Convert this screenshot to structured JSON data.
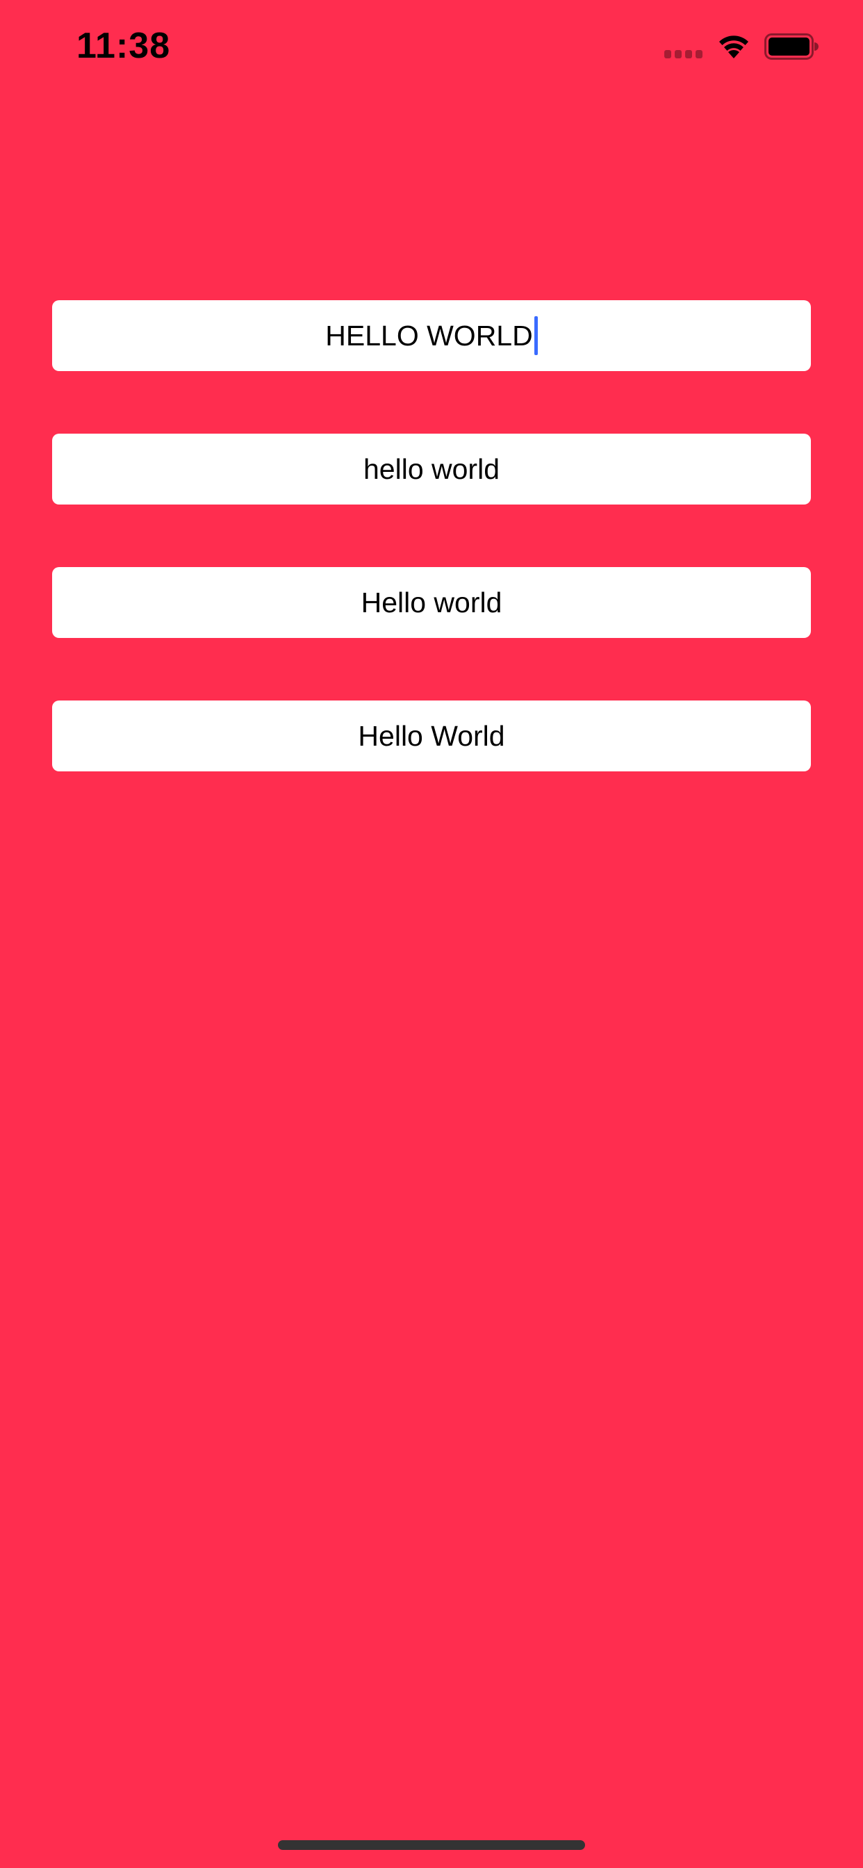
{
  "status_bar": {
    "time": "11:38",
    "signal_icon": "cellular-signal-icon",
    "wifi_icon": "wifi-icon",
    "battery_icon": "battery-icon"
  },
  "fields": [
    {
      "value": "HELLO WORLD",
      "focused": true
    },
    {
      "value": "hello world",
      "focused": false
    },
    {
      "value": "Hello world",
      "focused": false
    },
    {
      "value": "Hello World",
      "focused": false
    }
  ],
  "colors": {
    "background": "#FF2D4F",
    "field_background": "#FFFFFF",
    "caret": "#3A6BFF"
  }
}
